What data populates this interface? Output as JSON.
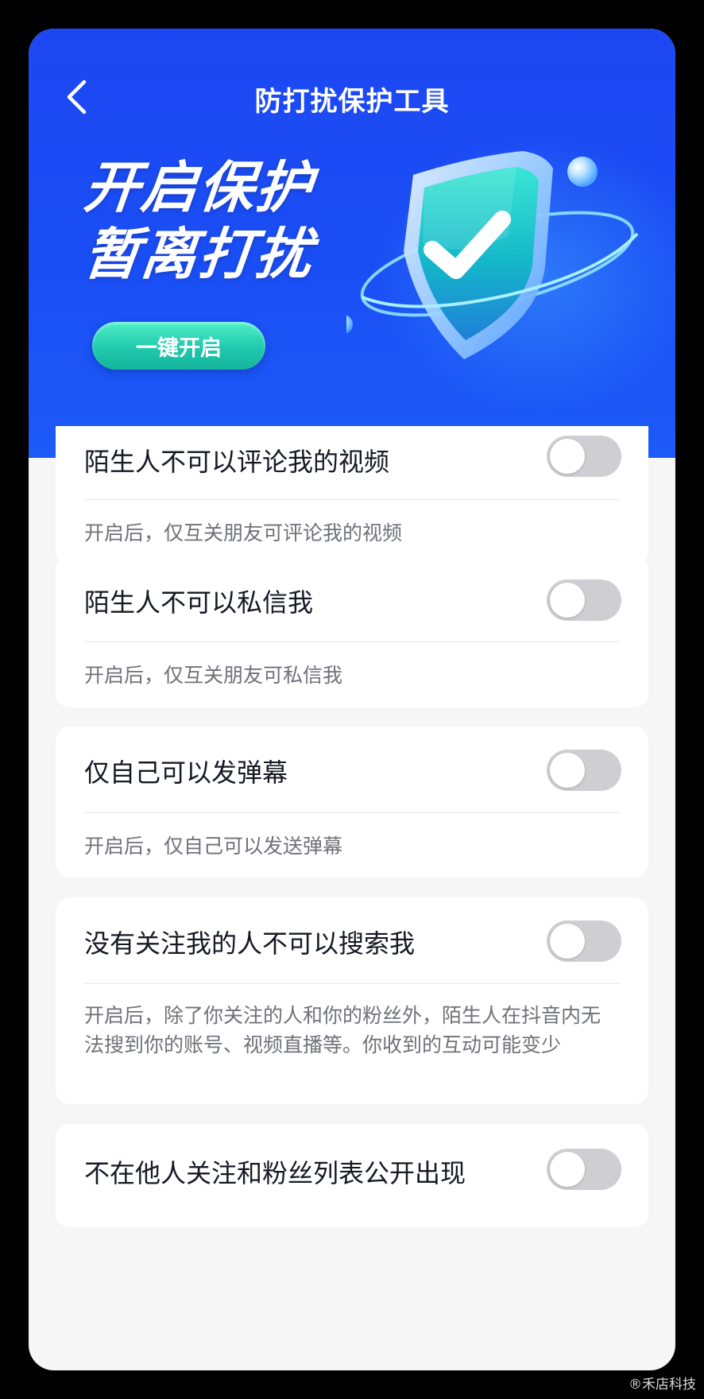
{
  "nav": {
    "title": "防打扰保护工具"
  },
  "hero": {
    "slogan_line1": "开启保护",
    "slogan_line2": "暂离打扰",
    "button_label": "一键开启"
  },
  "settings": [
    {
      "title": "陌生人不可以评论我的视频",
      "description": "开启后，仅互关朋友可评论我的视频",
      "enabled": false
    },
    {
      "title": "陌生人不可以私信我",
      "description": "开启后，仅互关朋友可私信我",
      "enabled": false
    },
    {
      "title": "仅自己可以发弹幕",
      "description": "开启后，仅自己可以发送弹幕",
      "enabled": false
    },
    {
      "title": "没有关注我的人不可以搜索我",
      "description": "开启后，除了你关注的人和你的粉丝外，陌生人在抖音内无法搜到你的账号、视频直播等。你收到的互动可能变少",
      "enabled": false
    },
    {
      "title": "不在他人关注和粉丝列表公开出现",
      "enabled": false
    }
  ],
  "watermark": "®禾店科技",
  "icons": {
    "back": "chevron-left-icon",
    "hero": "shield-check-icon"
  },
  "colors": {
    "hero_blue": "#1d47f2",
    "button_teal": "#1fc9ad",
    "toggle_off": "#cfcfd3"
  }
}
